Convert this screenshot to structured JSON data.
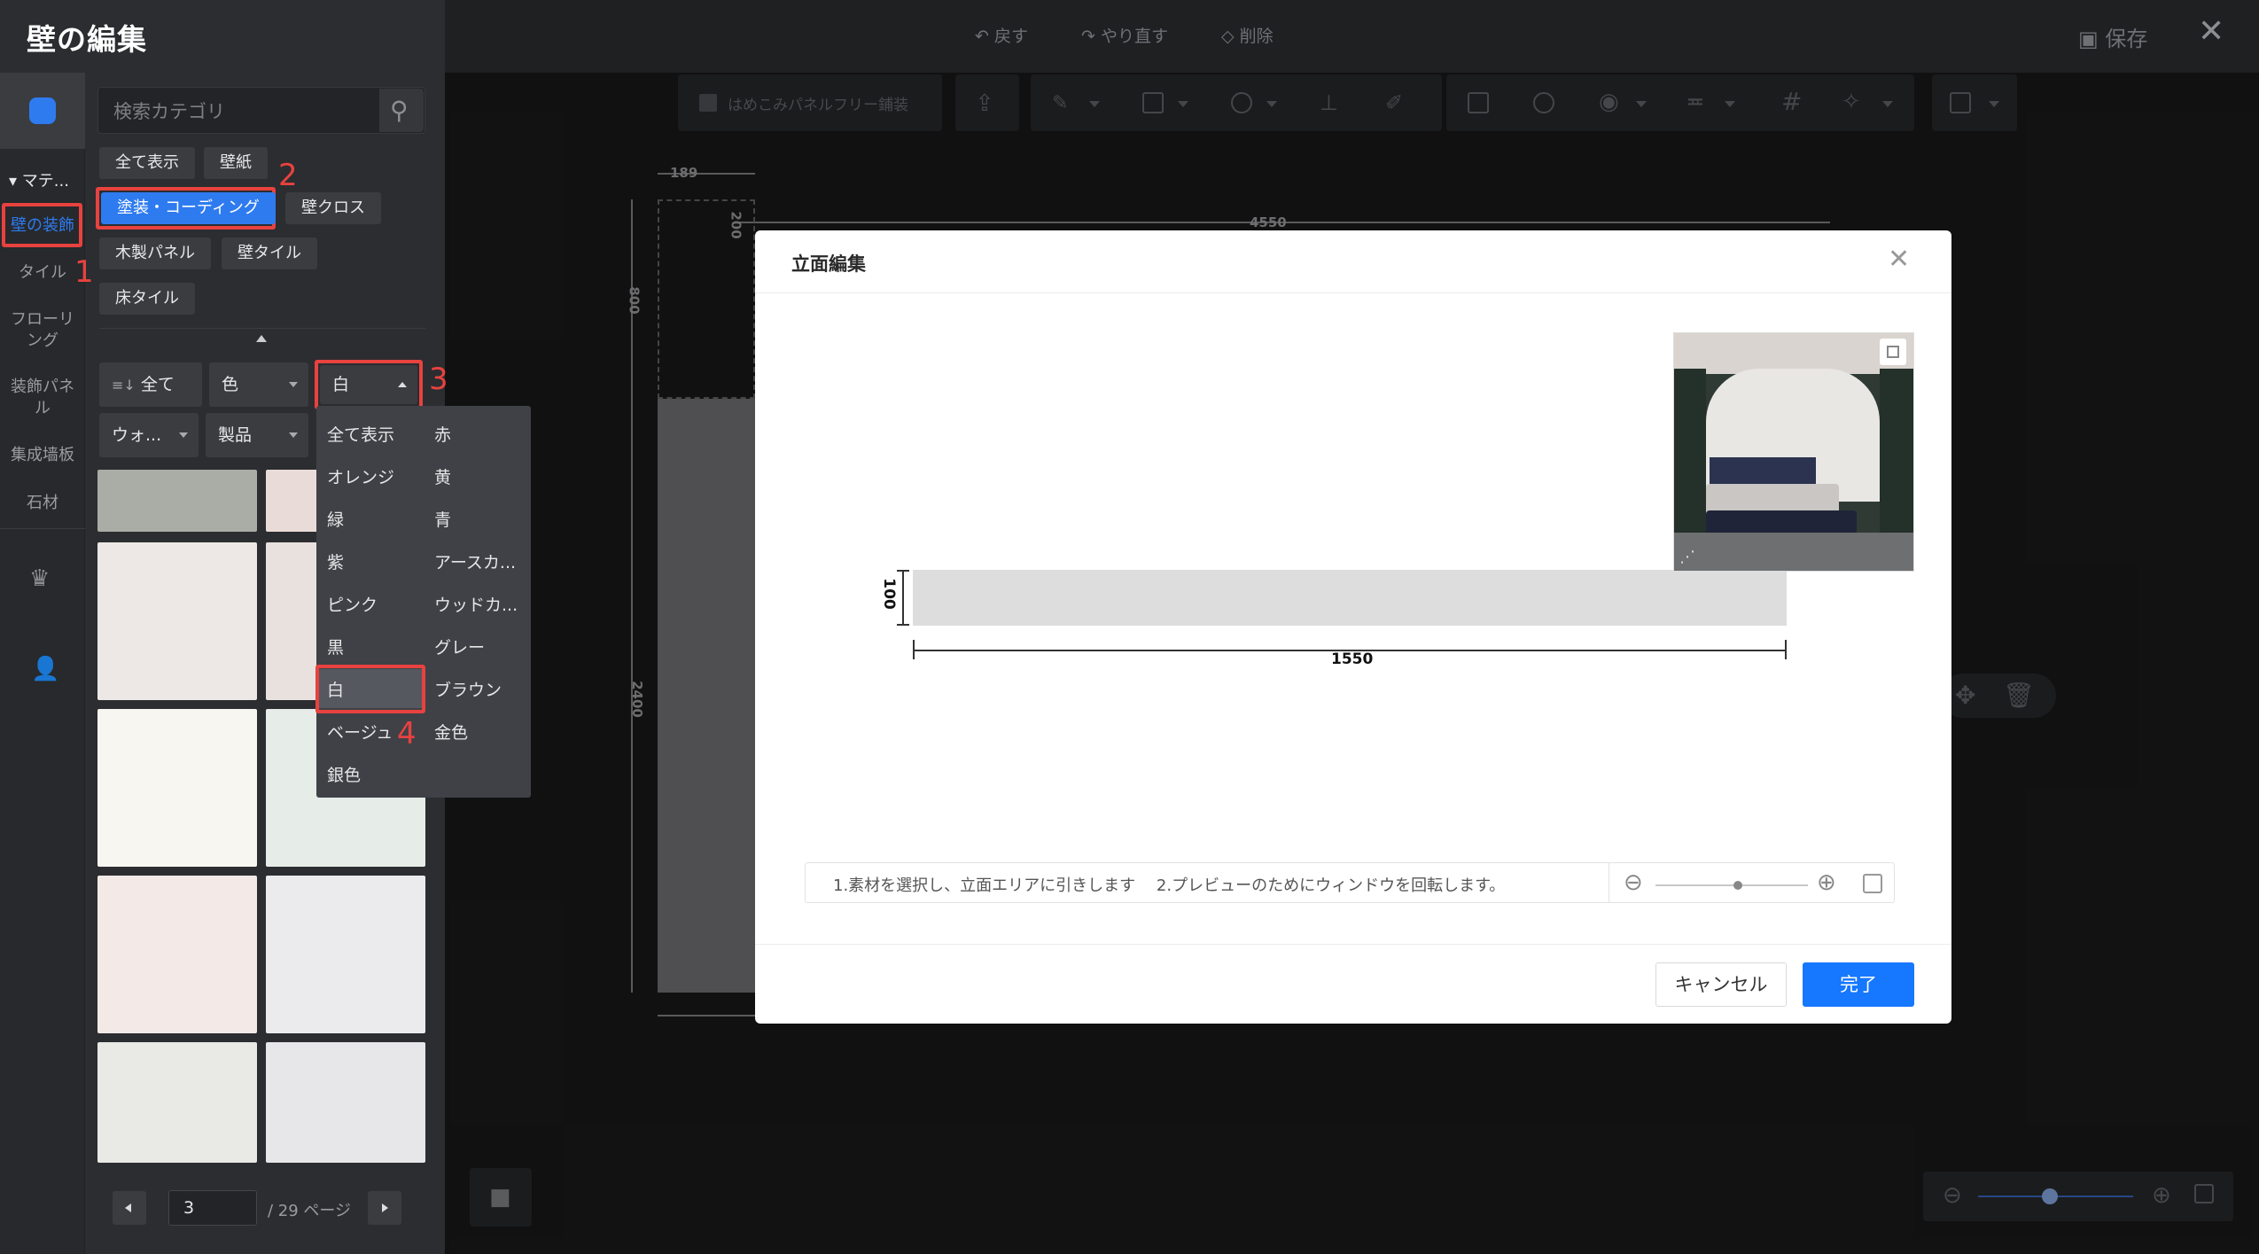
{
  "panel": {
    "title": "壁の編集",
    "search_placeholder": "検索カテゴリ",
    "section_label": "マテ...",
    "rail_items": [
      "壁の装飾",
      "タイル",
      "フローリング",
      "装飾パネル",
      "集成墙板",
      "石材"
    ],
    "categories": [
      "全て表示",
      "壁紙",
      "塗装・コーディング",
      "壁クロス",
      "木製パネル",
      "壁タイル",
      "床タイル"
    ],
    "filters": {
      "sort": "全て",
      "color_filter": "色",
      "selected_color": "白",
      "style": "ウォ...",
      "product": "製品"
    },
    "color_options": [
      [
        "全て表示",
        "赤"
      ],
      [
        "オレンジ",
        "黄"
      ],
      [
        "緑",
        "青"
      ],
      [
        "紫",
        "アースカ..."
      ],
      [
        "ピンク",
        "ウッドカ..."
      ],
      [
        "黒",
        "グレー"
      ],
      [
        "白",
        "ブラウン"
      ],
      [
        "ベージュ",
        "金色"
      ],
      [
        "銀色",
        ""
      ]
    ],
    "swatch_colors": [
      "#a9ada6",
      "#e9dcd8",
      "#ede8e5",
      "#e9e1de",
      "#f7f6f1",
      "#e6ece8",
      "#f3e9e6",
      "#ebebee",
      "#e9e9e6",
      "#e7e7e9"
    ],
    "pager": {
      "current": "3",
      "total_label": "/ 29 ページ"
    }
  },
  "steps": [
    "1",
    "2",
    "3",
    "4"
  ],
  "topbar": {
    "undo": "戻す",
    "redo": "やり直す",
    "delete": "削除",
    "save": "保存",
    "toolbar_checkbox_label": "はめこみパネルフリー鋪装"
  },
  "canvas": {
    "dims": {
      "d189": "189",
      "d4550": "4550",
      "d200": "200",
      "d800": "800",
      "d2400": "2400"
    }
  },
  "modal": {
    "title": "立面編集",
    "dim_height": "100",
    "dim_width": "1550",
    "hint": "1.素材を選択し、立面エリアに引きします　 2.プレビューのためにウィンドウを回転します。",
    "cancel": "キャンセル",
    "done": "完了"
  },
  "colors": {
    "accent": "#1677ff",
    "highlight": "#e8423f"
  }
}
